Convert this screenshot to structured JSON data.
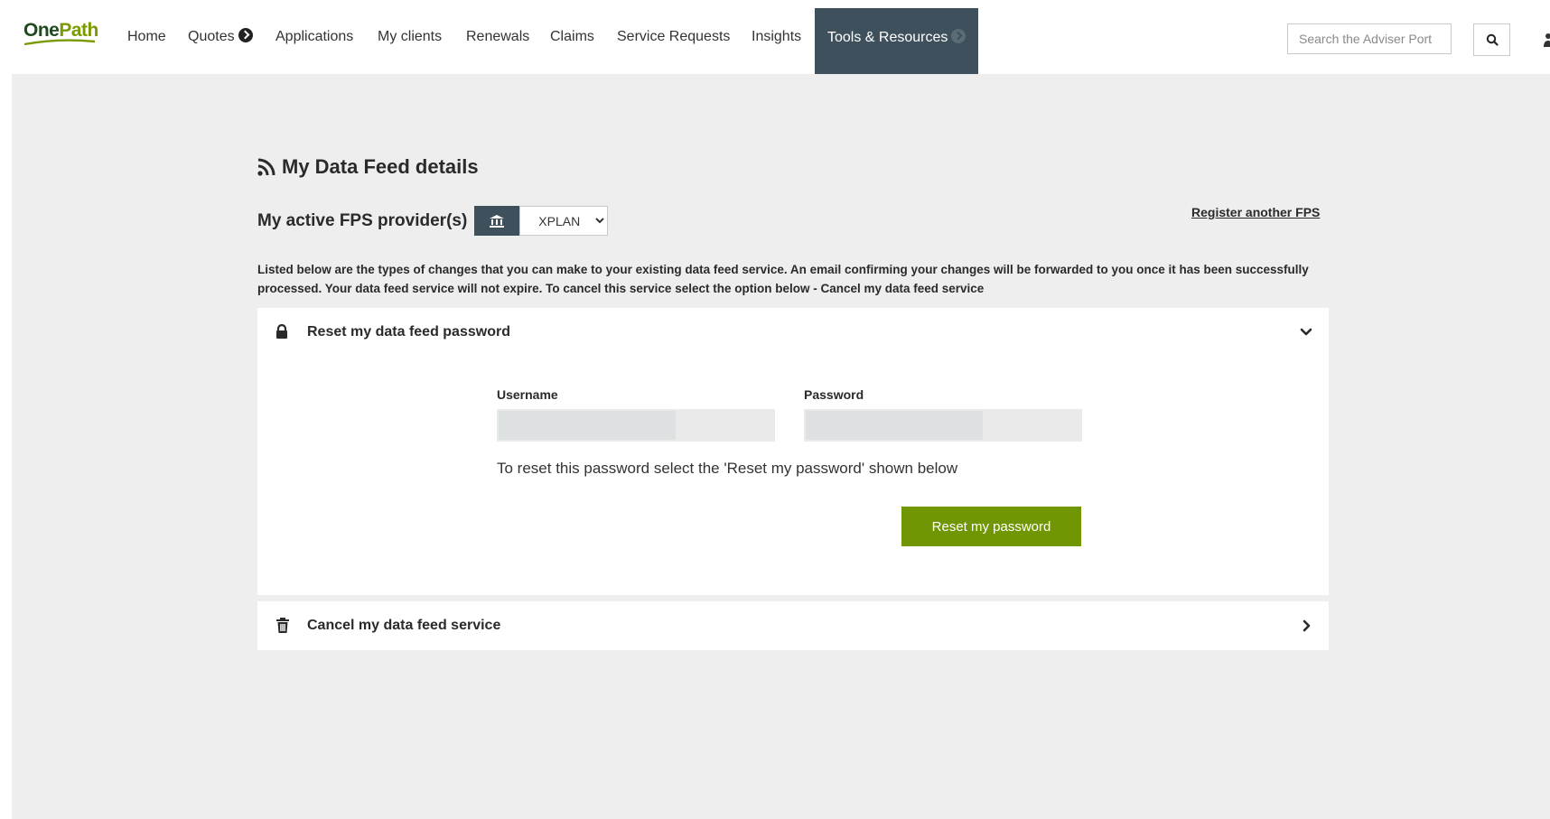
{
  "brand": {
    "logo_part1": "One",
    "logo_part2": "Path",
    "colors": {
      "logo_dark": "#1e4a1e",
      "logo_green": "#7a9a01"
    }
  },
  "nav": {
    "items": [
      {
        "label": "Home"
      },
      {
        "label": "Quotes",
        "icon": "circle-chevron-right-icon"
      },
      {
        "label": "Applications"
      },
      {
        "label": "My clients"
      },
      {
        "label": "Renewals"
      },
      {
        "label": "Claims"
      },
      {
        "label": "Service Requests"
      },
      {
        "label": "Insights"
      },
      {
        "label": "Tools & Resources",
        "icon": "circle-chevron-right-icon",
        "active": true
      }
    ],
    "active_color": "#3e505c",
    "search_placeholder": "Search the Adviser Port",
    "search_icon": "search-icon"
  },
  "page": {
    "title": "My Data Feed details",
    "title_icon": "rss-feed-icon",
    "fps_label": "My active FPS provider(s)",
    "fps_icon": "bank-icon",
    "fps_selected": "XPLAN",
    "register_link": "Register another FPS",
    "intro": "Listed below are the types of changes that you can make to your existing data feed service. An email confirming your changes will be forwarded to you once it has been successfully processed. Your data feed service will not expire. To cancel this service select the option below - Cancel my data feed service"
  },
  "reset_panel": {
    "title": "Reset my data feed password",
    "icon": "lock-icon",
    "expanded": true,
    "username_label": "Username",
    "password_label": "Password",
    "note": "To reset this password select the 'Reset my password' shown below",
    "button_label": "Reset my password",
    "button_color": "#709603"
  },
  "cancel_panel": {
    "title": "Cancel my data feed service",
    "icon": "trash-icon",
    "expanded": false
  }
}
